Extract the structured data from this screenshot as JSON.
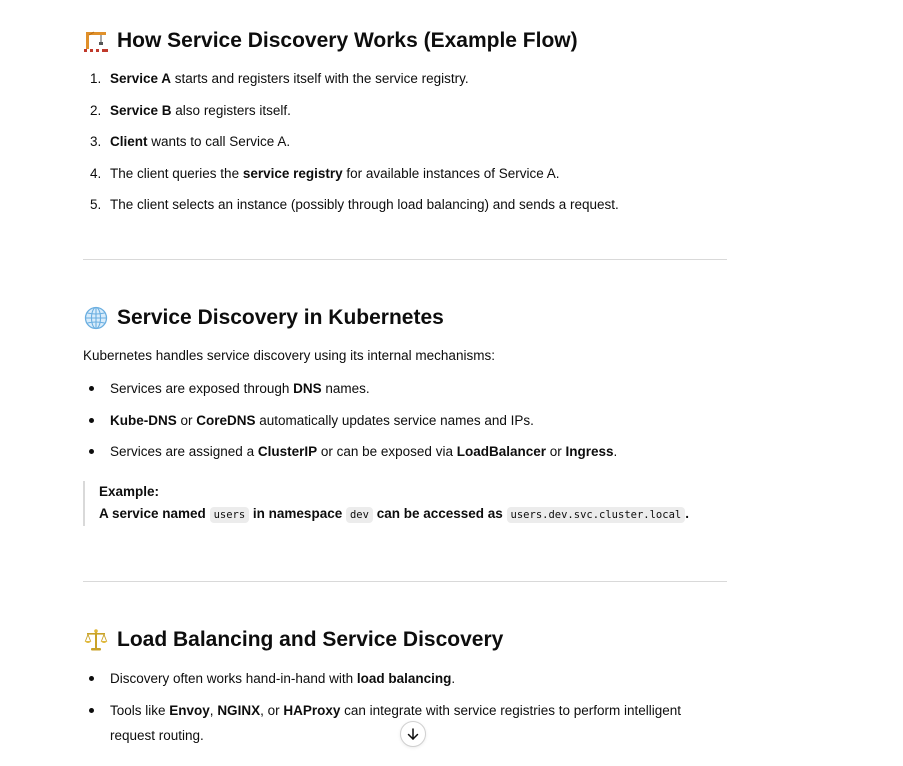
{
  "sections": {
    "flow": {
      "icon": "construction-crane-emoji",
      "title": "How Service Discovery Works (Example Flow)",
      "steps": [
        {
          "num": "1.",
          "bold": "Service A",
          "rest": " starts and registers itself with the service registry."
        },
        {
          "num": "2.",
          "bold": "Service B",
          "rest": " also registers itself."
        },
        {
          "num": "3.",
          "bold": "Client",
          "rest": " wants to call Service A."
        },
        {
          "num": "4.",
          "pre": "The client queries the ",
          "bold": "service registry",
          "rest": " for available instances of Service A."
        },
        {
          "num": "5.",
          "pre": "The client selects an instance (possibly through load balancing) and sends a request."
        }
      ]
    },
    "kubernetes": {
      "icon": "globe-emoji",
      "title": "Service Discovery in Kubernetes",
      "intro": "Kubernetes handles service discovery using its internal mechanisms:",
      "bullets": [
        {
          "a": "Services are exposed through ",
          "b": "DNS",
          "c": " names."
        },
        {
          "b1": "Kube-DNS",
          "c1": " or ",
          "b2": "CoreDNS",
          "c2": " automatically updates service names and IPs."
        },
        {
          "a": "Services are assigned a ",
          "b1": "ClusterIP",
          "c1": " or can be exposed via ",
          "b2": "LoadBalancer",
          "c2": " or ",
          "b3": "Ingress",
          "c3": "."
        }
      ],
      "example": {
        "label": "Example:",
        "t1": "A service named ",
        "code1": "users",
        "t2": " in namespace ",
        "code2": "dev",
        "t3": " can be accessed as ",
        "code3": "users.dev.svc.cluster.local",
        "t4": "."
      }
    },
    "load_balancing": {
      "icon": "balance-scale-emoji",
      "title": "Load Balancing and Service Discovery",
      "bullets": [
        {
          "a": "Discovery often works hand-in-hand with ",
          "b": "load balancing",
          "c": "."
        },
        {
          "a": "Tools like ",
          "b1": "Envoy",
          "c1": ", ",
          "b2": "NGINX",
          "c2": ", or ",
          "b3": "HAProxy",
          "c3": " can integrate with service registries to perform intelligent request routing."
        }
      ]
    }
  },
  "scroll_button": {
    "icon": "arrow-down-icon"
  },
  "colors": {
    "text": "#0d0d0d",
    "divider": "#d9d9d9",
    "code_bg": "#ececec"
  }
}
